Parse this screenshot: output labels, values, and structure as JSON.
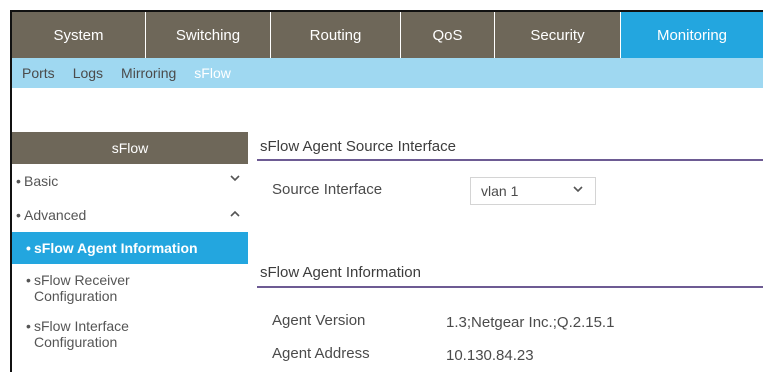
{
  "tabs": [
    {
      "label": "System"
    },
    {
      "label": "Switching"
    },
    {
      "label": "Routing"
    },
    {
      "label": "QoS"
    },
    {
      "label": "Security"
    },
    {
      "label": "Monitoring",
      "active": true
    }
  ],
  "subnav": [
    {
      "label": "Ports"
    },
    {
      "label": "Logs"
    },
    {
      "label": "Mirroring"
    },
    {
      "label": "sFlow",
      "active": true
    }
  ],
  "sidebar": {
    "title": "sFlow",
    "basic": {
      "label": "Basic",
      "icon": "chevron-down-icon"
    },
    "advanced": {
      "label": "Advanced",
      "icon": "chevron-up-icon"
    },
    "items": [
      {
        "label": "sFlow Agent Information",
        "active": true
      },
      {
        "line1": "sFlow Receiver",
        "line2": "Configuration"
      },
      {
        "line1": "sFlow Interface",
        "line2": "Configuration"
      }
    ],
    "bullet": "•"
  },
  "source_section": {
    "title": "sFlow Agent Source Interface",
    "source_interface_label": "Source Interface",
    "source_interface_value": "vlan 1"
  },
  "agent_section": {
    "title": "sFlow Agent Information",
    "agent_version_label": "Agent Version",
    "agent_version_value": "1.3;Netgear Inc.;Q.2.15.1",
    "agent_address_label": "Agent Address",
    "agent_address_value": "10.130.84.23"
  },
  "colors": {
    "tab_bg": "#6e6759",
    "active_blue": "#23a6df",
    "subnav_bg": "#9fd8f1",
    "section_rule": "#6d5b93"
  }
}
